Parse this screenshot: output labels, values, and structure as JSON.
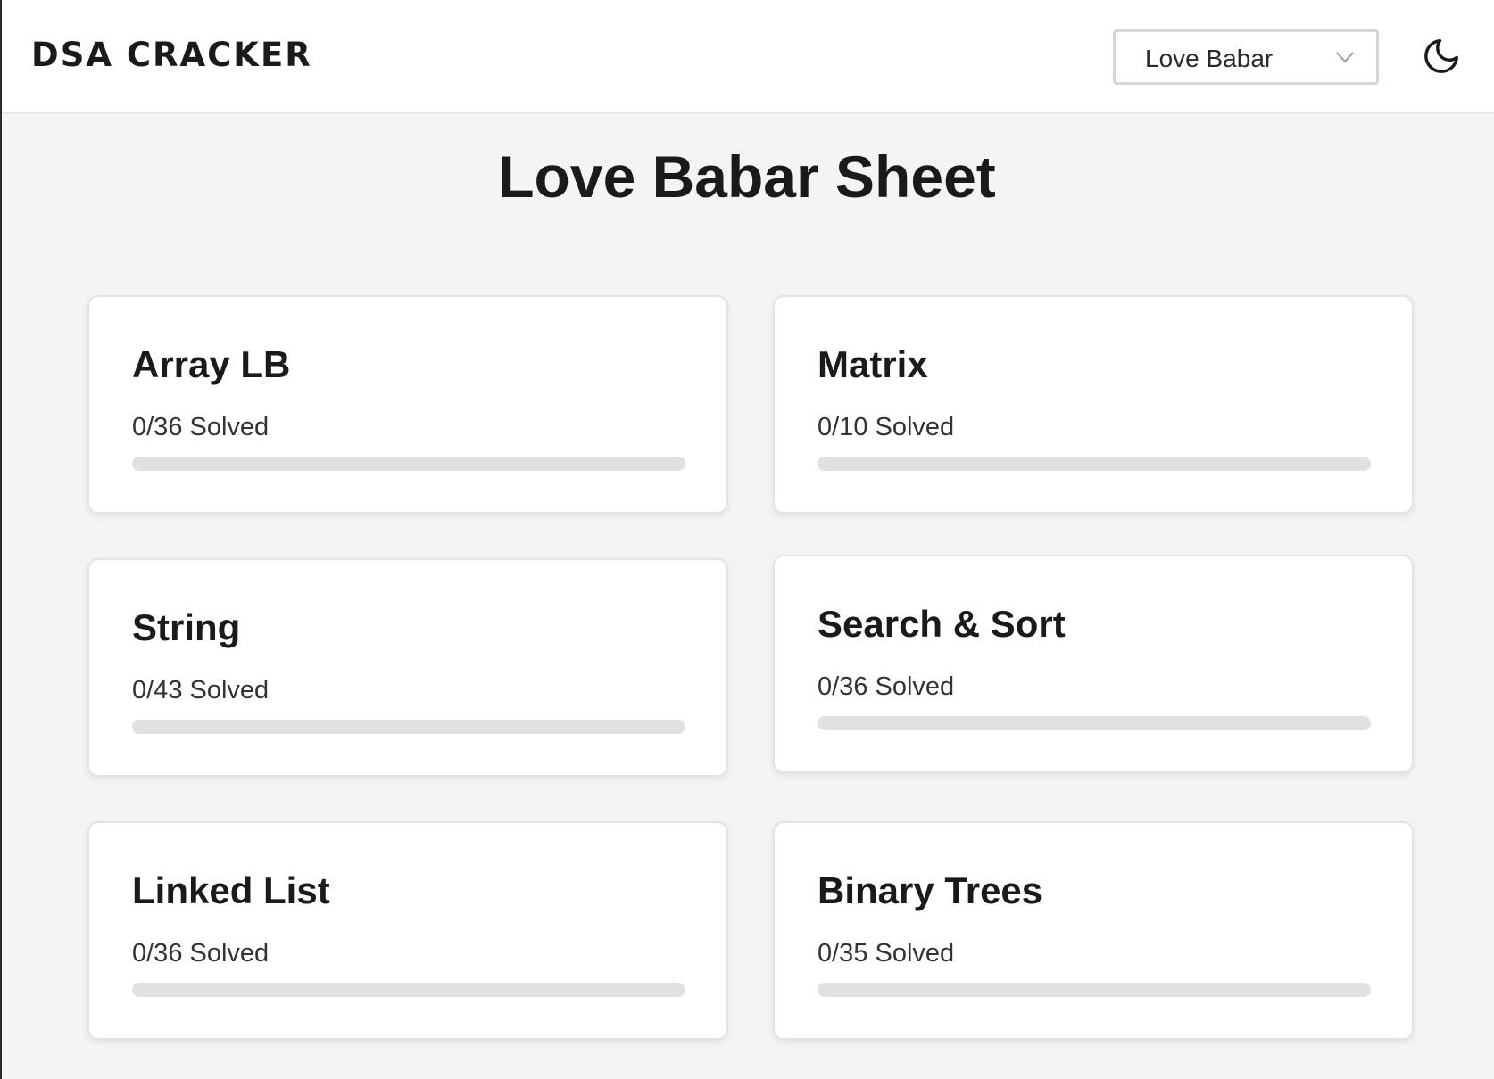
{
  "header": {
    "brand": "DSA CRACKER",
    "sheet_select": {
      "value": "Love Babar",
      "icon": "chevron-down-icon"
    },
    "theme_toggle_icon": "moon-icon"
  },
  "main": {
    "title": "Love Babar Sheet",
    "topics": [
      {
        "name": "Array LB",
        "solved": 0,
        "total": 36,
        "progress_text": "0/36 Solved"
      },
      {
        "name": "Matrix",
        "solved": 0,
        "total": 10,
        "progress_text": "0/10 Solved"
      },
      {
        "name": "String",
        "solved": 0,
        "total": 43,
        "progress_text": "0/43 Solved"
      },
      {
        "name": "Search & Sort",
        "solved": 0,
        "total": 36,
        "progress_text": "0/36 Solved"
      },
      {
        "name": "Linked List",
        "solved": 0,
        "total": 36,
        "progress_text": "0/36 Solved"
      },
      {
        "name": "Binary Trees",
        "solved": 0,
        "total": 35,
        "progress_text": "0/35 Solved"
      }
    ]
  },
  "colors": {
    "background": "#f4f4f4",
    "card": "#ffffff",
    "progress_track": "#e1e1e1",
    "text": "#1a1a1a"
  }
}
